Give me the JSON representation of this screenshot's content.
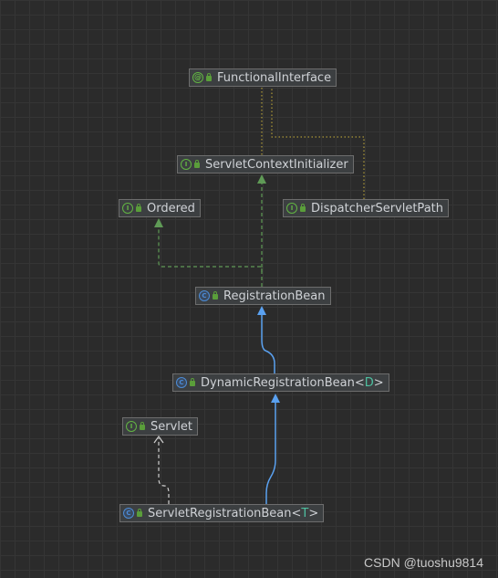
{
  "nodes": {
    "functional_interface": {
      "kind": "annotation",
      "kind_glyph": "@",
      "name": "FunctionalInterface"
    },
    "servlet_context_initializer": {
      "kind": "interface",
      "kind_glyph": "I",
      "name": "ServletContextInitializer"
    },
    "ordered": {
      "kind": "interface",
      "kind_glyph": "I",
      "name": "Ordered"
    },
    "dispatcher_servlet_path": {
      "kind": "interface",
      "kind_glyph": "I",
      "name": "DispatcherServletPath"
    },
    "registration_bean": {
      "kind": "class",
      "kind_glyph": "C",
      "name": "RegistrationBean"
    },
    "dynamic_registration_bean": {
      "kind": "class",
      "kind_glyph": "C",
      "name": "DynamicRegistrationBean",
      "type_open": "<",
      "type_param": "D",
      "type_close": ">"
    },
    "servlet": {
      "kind": "interface",
      "kind_glyph": "I",
      "name": "Servlet"
    },
    "servlet_registration_bean": {
      "kind": "class",
      "kind_glyph": "C",
      "name": "ServletRegistrationBean",
      "type_open": "<",
      "type_param": "T",
      "type_close": ">"
    }
  },
  "edge_colors": {
    "implements": "#5f9a56",
    "extends": "#5aa1f0",
    "annotated": "#c9b13a",
    "dependency": "#cfcfcf"
  },
  "watermark": "CSDN @tuoshu9814"
}
